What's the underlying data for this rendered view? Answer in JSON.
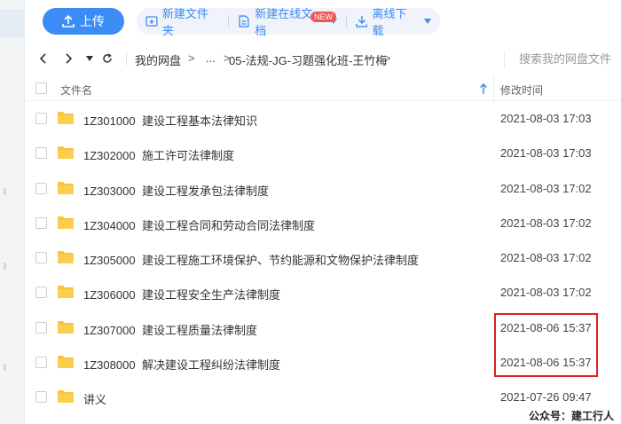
{
  "toolbar": {
    "upload_label": "上传",
    "new_folder_label": "新建文件夹",
    "new_doc_label": "新建在线文档",
    "new_badge": "NEW",
    "offline_download_label": "离线下载"
  },
  "breadcrumb": {
    "root": "我的网盘",
    "sep": ">",
    "ellipsis": "...",
    "current": "05-法规-JG-习题强化班-王竹梅"
  },
  "search": {
    "placeholder": "搜索我的网盘文件"
  },
  "table": {
    "col_name": "文件名",
    "col_time": "修改时间",
    "rows": [
      {
        "code": "1Z301000",
        "title": "建设工程基本法律知识",
        "time": "2021-08-03 17:03"
      },
      {
        "code": "1Z302000",
        "title": "施工许可法律制度",
        "time": "2021-08-03 17:03"
      },
      {
        "code": "1Z303000",
        "title": "建设工程发承包法律制度",
        "time": "2021-08-03 17:02"
      },
      {
        "code": "1Z304000",
        "title": "建设工程合同和劳动合同法律制度",
        "time": "2021-08-03 17:02"
      },
      {
        "code": "1Z305000",
        "title": "建设工程施工环境保护、节约能源和文物保护法律制度",
        "time": "2021-08-03 17:02"
      },
      {
        "code": "1Z306000",
        "title": "建设工程安全生产法律制度",
        "time": "2021-08-03 17:02"
      },
      {
        "code": "1Z307000",
        "title": "建设工程质量法律制度",
        "time": "2021-08-06 15:37"
      },
      {
        "code": "1Z308000",
        "title": "解决建设工程纠纷法律制度",
        "time": "2021-08-06 15:37"
      },
      {
        "code": "",
        "title": "讲义",
        "time": "2021-07-26 09:47"
      }
    ]
  },
  "watermark": "公众号：建工行人",
  "colors": {
    "accent": "#3b8cf5",
    "folder": "#f8c43a",
    "highlight": "#e02020"
  },
  "icons": [
    "upload-icon",
    "new-folder-icon",
    "new-doc-icon",
    "download-icon",
    "back-icon",
    "forward-icon",
    "refresh-icon",
    "folder-icon",
    "sort-up-icon"
  ]
}
